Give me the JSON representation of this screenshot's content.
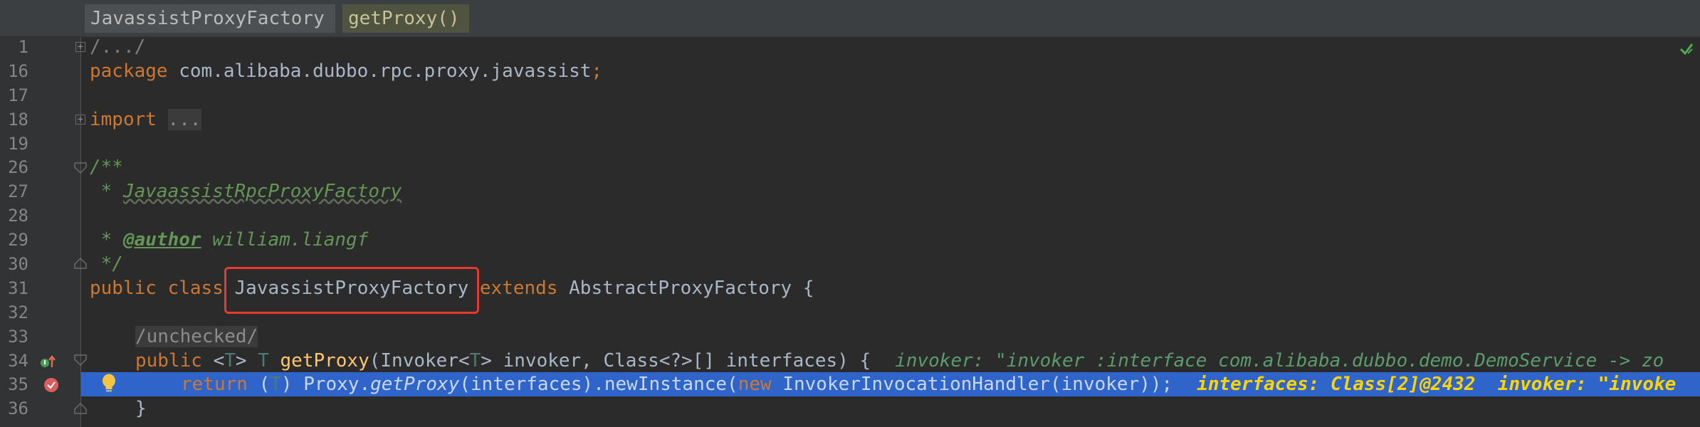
{
  "breadcrumb": {
    "class": "JavassistProxyFactory",
    "method": "getProxy()"
  },
  "line_numbers": [
    "1",
    "16",
    "17",
    "18",
    "19",
    "26",
    "27",
    "28",
    "29",
    "30",
    "31",
    "32",
    "33",
    "34",
    "35",
    "36"
  ],
  "code": {
    "l1": "/.../",
    "l16_kw": "package",
    "l16_rest": " com.alibaba.dubbo.rpc.proxy.javassist",
    "l16_semi": ";",
    "l18_kw": "import",
    "l18_fold": "...",
    "l26": "/**",
    "l27_star": " * ",
    "l27_text": "JavaassistRpcProxyFactory",
    "l29_star": " * ",
    "l29_tag": "@author",
    "l29_text": " william.liangf",
    "l30": " */",
    "l31_kw1": "public",
    "l31_kw2": "class",
    "l31_name": "JavassistProxyFactory",
    "l31_kw3": "extends",
    "l31_rest": "AbstractProxyFactory {",
    "l33_fold": "/unchecked/",
    "l34_kw": "public",
    "l34_lt": " <",
    "l34_T1": "T",
    "l34_gt": "> ",
    "l34_T2": "T",
    "l34_method": "getProxy",
    "l34_p1": "(Invoker<",
    "l34_T3": "T",
    "l34_p2": "> invoker, Class<?>[] interfaces) {",
    "l34_debug": "invoker: \"invoker :interface com.alibaba.dubbo.demo.DemoService -> zo",
    "l35_kw": "return",
    "l35_p1": " (",
    "l35_T": "T",
    "l35_p2": ") Proxy.",
    "l35_static": "getProxy",
    "l35_p3": "(interfaces).newInstance(",
    "l35_new": "new",
    "l35_p4": " InvokerInvocationHandler(invoker));",
    "l35_debug": "interfaces: Class[2]@2432  invoker: \"invoke",
    "l36": "}"
  },
  "icons": {
    "status": "checkmark-icon",
    "implements": "implements-override-icon",
    "breakpoint": "breakpoint-icon",
    "intention": "lightbulb-icon"
  },
  "colors": {
    "background": "#2b2b2b",
    "keyword": "#cc7832",
    "comment": "#629755",
    "selection": "#2f65ca",
    "highlight_box": "#e53b2f",
    "method": "#ffc66d"
  }
}
